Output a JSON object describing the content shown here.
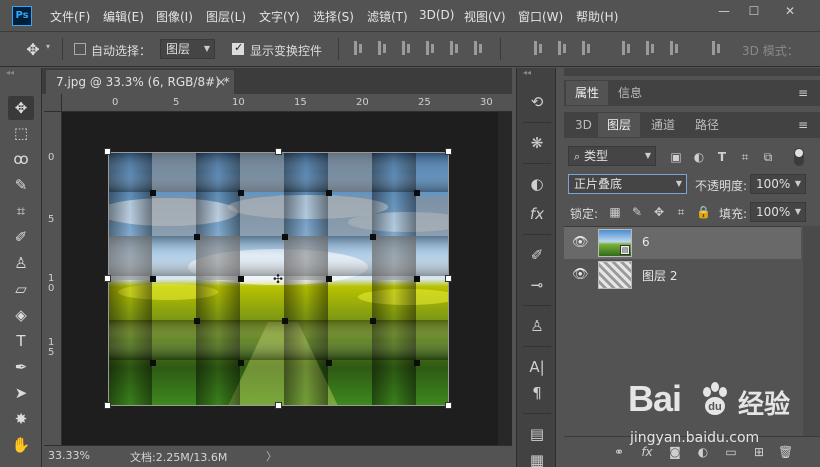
{
  "app": {
    "logo_text": "Ps"
  },
  "menu": [
    "文件(F)",
    "编辑(E)",
    "图像(I)",
    "图层(L)",
    "文字(Y)",
    "选择(S)",
    "滤镜(T)",
    "3D(D)",
    "视图(V)",
    "窗口(W)",
    "帮助(H)"
  ],
  "window_controls": {
    "minimize": "—",
    "maximize": "☐",
    "close": "✕"
  },
  "options": {
    "auto_select_label": "自动选择：",
    "auto_select_checked": false,
    "auto_select_value": "图层",
    "show_transform_label": "显示变换控件",
    "show_transform_checked": true,
    "mode_3d_label": "3D 模式："
  },
  "document": {
    "tab_title": "7.jpg @ 33.3% (6, RGB/8#) *",
    "tab_close": "×",
    "ruler_h": [
      "0",
      "5",
      "10",
      "15",
      "20",
      "25",
      "30"
    ],
    "ruler_v": [
      "0",
      "5",
      "10",
      "15"
    ],
    "zoom": "33.33%",
    "doc_info": "文档:2.25M/13.6M",
    "status_arrow": "〉"
  },
  "panels": {
    "top_tabs": [
      "属性",
      "信息"
    ],
    "tabs": [
      "3D",
      "图层",
      "通道",
      "路径"
    ],
    "active_tab": "图层",
    "filter_label": "类型",
    "blend_mode": "正片叠底",
    "opacity_label": "不透明度:",
    "opacity_value": "100%",
    "lock_label": "锁定:",
    "fill_label": "填充:",
    "fill_value": "100%",
    "layers": [
      {
        "name": "6",
        "selected": true,
        "visible": true
      },
      {
        "name": "图层 2",
        "selected": false,
        "visible": true
      }
    ],
    "bottom_icons": [
      "link-icon",
      "fx-icon",
      "mask-icon",
      "adjustment-icon",
      "group-icon",
      "new-layer-icon",
      "delete-icon"
    ]
  },
  "watermark": {
    "brand": "Bai",
    "brand_cn": "经验",
    "url": "jingyan.baidu.com"
  }
}
